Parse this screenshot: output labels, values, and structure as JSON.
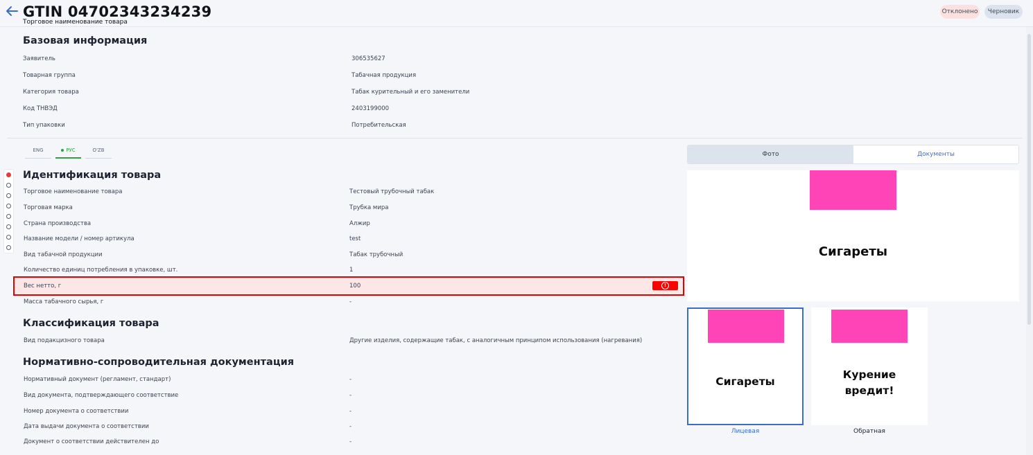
{
  "header": {
    "back_icon": "arrow-left-icon",
    "title": "GTIN 04702343234239",
    "subtitle": "Торговое наименование товара",
    "status_badges": [
      "Отклонено",
      "Черновик"
    ]
  },
  "basic_info": {
    "title": "Базовая информация",
    "rows": [
      {
        "label": "Заявитель",
        "value": "306535627"
      },
      {
        "label": "Товарная группа",
        "value": "Табачная продукция"
      },
      {
        "label": "Категория товара",
        "value": "Табак курительный и его заменители"
      },
      {
        "label": "Код ТНВЭД",
        "value": "2403199000"
      },
      {
        "label": "Тип упаковки",
        "value": "Потребительская"
      }
    ]
  },
  "language_tabs": {
    "items": [
      "ENG",
      "РУС",
      "O'ZB"
    ],
    "active": "РУС"
  },
  "identification": {
    "title": "Идентификация товара",
    "rows": [
      {
        "label": "Торговое наименование товара",
        "value": "Тестовый трубочный табак"
      },
      {
        "label": "Торговая марка",
        "value": "Трубка мира"
      },
      {
        "label": "Страна производства",
        "value": "Алжир"
      },
      {
        "label": "Название модели / номер артикула",
        "value": "test"
      },
      {
        "label": "Вид табачной продукции",
        "value": "Табак трубочный"
      },
      {
        "label": "Количество единиц потребления в упаковке, шт.",
        "value": "1"
      },
      {
        "label": "Вес нетто, г",
        "value": "100",
        "error": true
      },
      {
        "label": "Масса табачного сырья, г",
        "value": "-"
      }
    ]
  },
  "classification": {
    "title": "Классификация товара",
    "rows": [
      {
        "label": "Вид подакцизного товара",
        "value": "Другие изделия, содержащие табак, с аналогичным принципом использования (нагревания)"
      }
    ]
  },
  "documentation": {
    "title": "Нормативно-сопроводительная документация",
    "rows": [
      {
        "label": "Нормативный документ (регламент, стандарт)",
        "value": "-"
      },
      {
        "label": "Вид документа, подтверждающего соответствие",
        "value": "-"
      },
      {
        "label": "Номер документа о соответствии",
        "value": "-"
      },
      {
        "label": "Дата выдачи документа о соответствии",
        "value": "-"
      },
      {
        "label": "Документ о соответствии действителен до",
        "value": "-"
      }
    ]
  },
  "media": {
    "tabs": [
      "Фото",
      "Документы"
    ],
    "active_tab": "Фото",
    "preview_text": "Сигареты",
    "thumbnails": [
      {
        "text": "Сигареты",
        "caption": "Лицевая",
        "selected": true
      },
      {
        "text": "Курение вредит!",
        "caption": "Обратная",
        "selected": false
      }
    ]
  },
  "stepper": {
    "count": 8,
    "active_index": 0
  },
  "colors": {
    "accent_blue": "#3b6cc6",
    "error_red": "#e30000",
    "active_green": "#2f9e44",
    "packaging_pink": "#ff44b8"
  }
}
